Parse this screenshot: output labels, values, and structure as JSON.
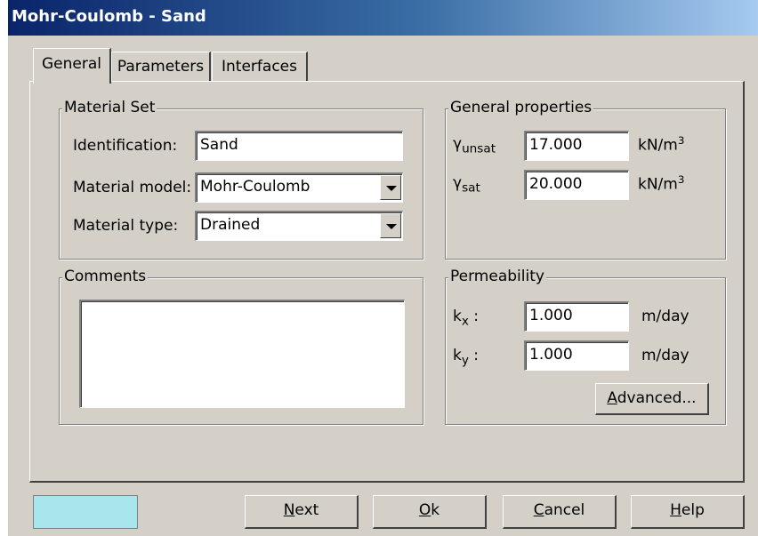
{
  "window": {
    "title": "Mohr-Coulomb - Sand"
  },
  "tabs": [
    {
      "label": "General"
    },
    {
      "label": "Parameters"
    },
    {
      "label": "Interfaces"
    }
  ],
  "material_set": {
    "title": "Material Set",
    "identification_label": "Identification:",
    "identification_value": "Sand",
    "model_label": "Material model:",
    "model_value": "Mohr-Coulomb",
    "type_label": "Material type:",
    "type_value": "Drained"
  },
  "general_properties": {
    "title": "General properties",
    "gamma_symbol": "γ",
    "unsat_sub": "unsat",
    "sat_sub": "sat",
    "unsat_value": "17.000",
    "sat_value": "20.000",
    "unit_base": "kN/m",
    "unit_exp": "3"
  },
  "comments": {
    "title": "Comments",
    "value": ""
  },
  "permeability": {
    "title": "Permeability",
    "k_symbol": "k",
    "kx_sub": "x",
    "ky_sub": "y",
    "colon": " :",
    "kx_value": "1.000",
    "ky_value": "1.000",
    "unit": "m/day",
    "advanced_button": {
      "prefix": "",
      "mnemonic": "A",
      "rest": "dvanced..."
    }
  },
  "buttons": {
    "next": {
      "mnemonic": "N",
      "rest": "ext"
    },
    "ok": {
      "mnemonic": "O",
      "rest": "k"
    },
    "cancel": {
      "mnemonic": "C",
      "rest": "ancel"
    },
    "help": {
      "mnemonic": "H",
      "rest": "elp"
    }
  },
  "colors": {
    "dialog_bg": "#d4d0c8",
    "title_gradient_start": "#0a246a",
    "status_indicator": "#a8e6ee"
  }
}
